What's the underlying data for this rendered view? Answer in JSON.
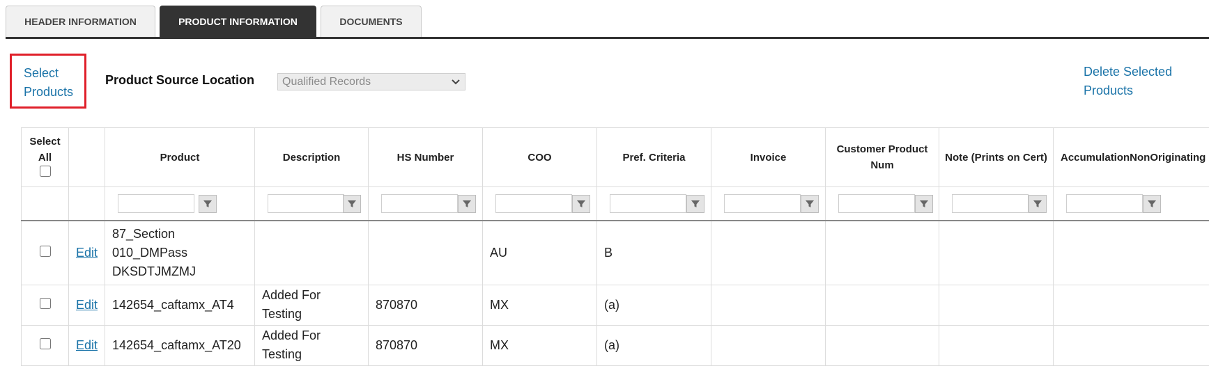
{
  "tabs": [
    {
      "label": "HEADER INFORMATION",
      "active": false
    },
    {
      "label": "PRODUCT INFORMATION",
      "active": true
    },
    {
      "label": "DOCUMENTS",
      "active": false
    }
  ],
  "toolbar": {
    "select_products_line1": "Select",
    "select_products_line2": "Products",
    "product_source_label": "Product Source Location",
    "product_source_value": "Qualified Records",
    "delete_line1": "Delete Selected",
    "delete_line2": "Products"
  },
  "grid": {
    "columns": {
      "select_all_line1": "Select",
      "select_all_line2": "All",
      "product": "Product",
      "description": "Description",
      "hs_number": "HS Number",
      "coo": "COO",
      "pref_criteria": "Pref. Criteria",
      "invoice": "Invoice",
      "customer_product_num": "Customer Product Num",
      "note": "Note (Prints on Cert)",
      "accumulation": "AccumulationNonOriginating"
    },
    "rows": [
      {
        "edit": "Edit",
        "product_l1": "87_Section",
        "product_l2": "010_DMPass",
        "product_l3": "DKSDTJMZMJ",
        "description_l1": "",
        "description_l2": "",
        "hs_number": "",
        "coo": "AU",
        "pref_criteria": "B",
        "invoice": "",
        "customer_product_num": "",
        "note": "",
        "accumulation": ""
      },
      {
        "edit": "Edit",
        "product_l1": "142654_caftamx_AT4",
        "product_l2": "",
        "product_l3": "",
        "description_l1": "Added For",
        "description_l2": "Testing",
        "hs_number": "870870",
        "coo": "MX",
        "pref_criteria": "(a)",
        "invoice": "",
        "customer_product_num": "",
        "note": "",
        "accumulation": ""
      },
      {
        "edit": "Edit",
        "product_l1": "142654_caftamx_AT20",
        "product_l2": "",
        "product_l3": "",
        "description_l1": "Added For",
        "description_l2": "Testing",
        "hs_number": "870870",
        "coo": "MX",
        "pref_criteria": "(a)",
        "invoice": "",
        "customer_product_num": "",
        "note": "",
        "accumulation": ""
      }
    ]
  },
  "colors": {
    "active_tab": "#333333",
    "link": "#1a73a8",
    "highlight_border": "#e0202a"
  },
  "icons": {
    "filter": "funnel-icon",
    "dropdown": "chevron-down-icon"
  }
}
